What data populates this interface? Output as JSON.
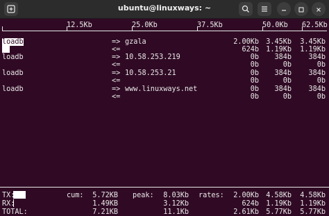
{
  "window": {
    "title": "ubuntu@linuxways: ~"
  },
  "icons": {
    "new_tab": "terminal-tab-icon",
    "search": "search-icon",
    "menu": "hamburger-menu-icon",
    "minimize": "minimize-icon",
    "maximize": "maximize-icon",
    "close": "close-icon"
  },
  "scale": {
    "ticks": [
      "12.5Kb",
      "25.0Kb",
      "37.5Kb",
      "50.0Kb",
      "62.5Kb"
    ]
  },
  "connections": [
    {
      "host": "loadb",
      "out_arrow": "=>",
      "in_arrow": "<=",
      "remote": "gzala",
      "out": [
        "2.00Kb",
        "3.45Kb",
        "3.45Kb"
      ],
      "in": [
        "624b",
        "1.19Kb",
        "1.19Kb"
      ]
    },
    {
      "host": "loadb",
      "out_arrow": "=>",
      "in_arrow": "<=",
      "remote": "10.58.253.219",
      "out": [
        "0b",
        "384b",
        "384b"
      ],
      "in": [
        "0b",
        "0b",
        "0b"
      ]
    },
    {
      "host": "loadb",
      "out_arrow": "=>",
      "in_arrow": "<=",
      "remote": "10.58.253.21",
      "out": [
        "0b",
        "384b",
        "384b"
      ],
      "in": [
        "0b",
        "0b",
        "0b"
      ]
    },
    {
      "host": "loadb",
      "out_arrow": "=>",
      "in_arrow": "<=",
      "remote": "www.linuxways.net",
      "out": [
        "0b",
        "384b",
        "384b"
      ],
      "in": [
        "0b",
        "0b",
        "0b"
      ]
    }
  ],
  "totals": {
    "cum_label": "cum:",
    "peak_label": "peak:",
    "rates_label": "rates:",
    "tx": {
      "label": "TX:",
      "cum": "5.72KB",
      "peak": "8.03Kb",
      "rates": [
        "2.00Kb",
        "4.58Kb",
        "4.58Kb"
      ]
    },
    "rx": {
      "label": "RX:",
      "cum": "1.49KB",
      "peak": "3.12Kb",
      "rates": [
        "624b",
        "1.19Kb",
        "1.19Kb"
      ]
    },
    "total": {
      "label": "TOTAL:",
      "cum": "7.21KB",
      "peak": "11.1Kb",
      "rates": [
        "2.61Kb",
        "5.77Kb",
        "5.77Kb"
      ]
    }
  },
  "colors": {
    "terminal_bg": "#300a24",
    "titlebar_bg": "#2c2c2c",
    "text": "#e8e8e8"
  }
}
